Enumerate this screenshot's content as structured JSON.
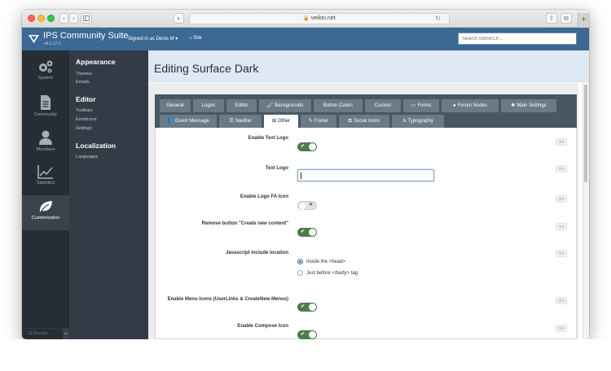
{
  "browser": {
    "url": "veilon.net",
    "back_icon": "chevron-left-icon",
    "forward_icon": "chevron-right-icon",
    "sidebar_icon": "sidebar-icon",
    "share_icon": "share-icon",
    "tabs_icon": "tabs-icon",
    "new_tab": "+"
  },
  "header": {
    "title": "IPS Community Suite",
    "version": "v4.1.17.1",
    "signed_in": "Signed in as Denis M ▾",
    "site_link": "Site",
    "search_placeholder": "Search AdminCP..."
  },
  "rail": {
    "items": [
      {
        "label": "System",
        "icon": "gears-icon",
        "active": false
      },
      {
        "label": "Community",
        "icon": "document-icon",
        "active": false
      },
      {
        "label": "Members",
        "icon": "user-icon",
        "active": false
      },
      {
        "label": "Statistics",
        "icon": "line-chart-icon",
        "active": false
      },
      {
        "label": "Customization",
        "icon": "leaf-icon",
        "active": true
      }
    ],
    "footer": "Reorder",
    "footer_arrow": "▸"
  },
  "submenu": {
    "sections": [
      {
        "title": "Appearance",
        "items": [
          "Themes",
          "Emails"
        ]
      },
      {
        "title": "Editor",
        "items": [
          "Toolbars",
          "Emoticons",
          "Settings"
        ]
      },
      {
        "title": "Localization",
        "items": [
          "Languages"
        ]
      }
    ]
  },
  "page": {
    "title": "Editing Surface Dark"
  },
  "tabs": {
    "row1": [
      {
        "label": "General",
        "icon": ""
      },
      {
        "label": "Logos",
        "icon": ""
      },
      {
        "label": "Editor",
        "icon": ""
      },
      {
        "label": "Backgrounds",
        "icon": "brush-icon"
      },
      {
        "label": "Button Colors",
        "icon": ""
      },
      {
        "label": "Custom",
        "icon": ""
      },
      {
        "label": "Forms",
        "icon": "form-icon"
      },
      {
        "label": "Forum Nodes",
        "icon": "comments-icon"
      },
      {
        "label": "Main Settings",
        "icon": "cog-icon"
      }
    ],
    "row2": [
      {
        "label": "Guest Message",
        "icon": "users-icon"
      },
      {
        "label": "NavBar",
        "icon": "bars-icon"
      },
      {
        "label": "Other",
        "icon": "plus-square-icon",
        "active": true
      },
      {
        "label": "Footer",
        "icon": "pencil-icon"
      },
      {
        "label": "Social Icons",
        "icon": "share-square-icon"
      },
      {
        "label": "Typography",
        "icon": "font-icon"
      }
    ]
  },
  "form": {
    "enable_text_logo": {
      "label": "Enable Text Logo",
      "value": true
    },
    "text_logo": {
      "label": "Text Logo",
      "value": ""
    },
    "enable_logo_fa_icon": {
      "label": "Enable Logo FA Icon",
      "value": false
    },
    "remove_create_button": {
      "label": "Remove button \"Create new content\"",
      "value": true
    },
    "javascript_location": {
      "label": "Javascript include location",
      "options": [
        "Inside the <head>",
        "Just before </body> tag"
      ],
      "selected": 0
    },
    "enable_menu_icons": {
      "label": "Enable Menu Icons (UserLinks & CreateNew Menus)",
      "value": true
    },
    "enable_compose_icon": {
      "label": "Enable Compose Icon",
      "value": true
    }
  },
  "colors": {
    "header_bg": "#3c6994",
    "rail_bg": "#262d35",
    "submenu_bg": "#333c46",
    "tabbar_bg": "#485764",
    "toggle_on": "#4c7d4a"
  }
}
